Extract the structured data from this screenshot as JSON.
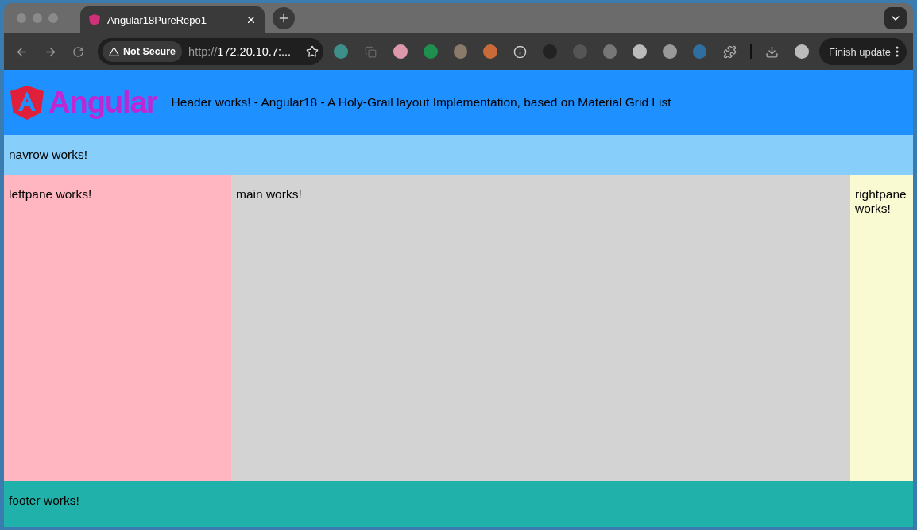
{
  "browser": {
    "tab": {
      "title": "Angular18PureRepo1",
      "selected": true
    },
    "security": "Not Secure",
    "url_prefix": "http://",
    "url_host": "172.20.10.7:...",
    "update_button": "Finish update"
  },
  "header": {
    "logo_text": "Angular",
    "text": "Header works! - Angular18 - A Holy-Grail layout Implementation, based on Material Grid List"
  },
  "navrow": {
    "text": "navrow works!"
  },
  "leftpane": {
    "text": "leftpane works!"
  },
  "main": {
    "text": "main works!"
  },
  "rightpane": {
    "text": "rightpane works!"
  },
  "footer": {
    "text": "footer works!"
  }
}
